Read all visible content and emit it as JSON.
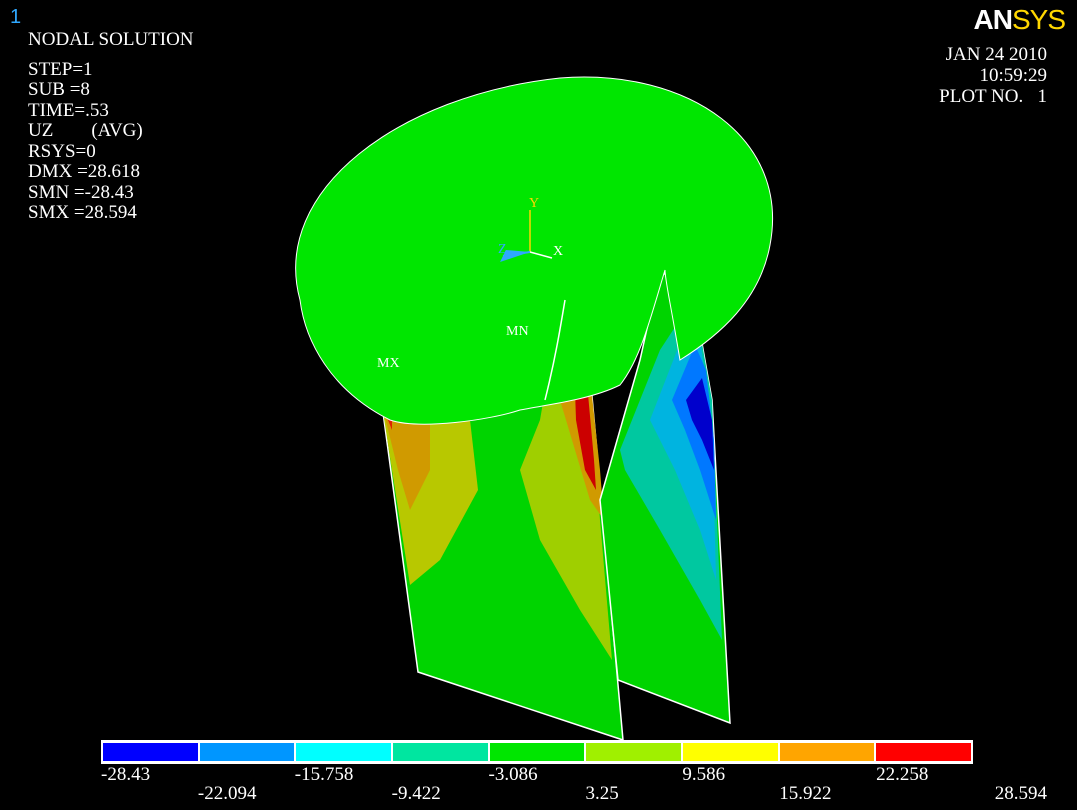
{
  "window_number": "1",
  "logo": {
    "part1": "AN",
    "part2": "SYS"
  },
  "info_lines": [
    "NODAL SOLUTION",
    "STEP=1",
    "SUB =8",
    "TIME=.53",
    "UZ        (AVG)",
    "RSYS=0",
    "DMX =28.618",
    "SMN =-28.43",
    "SMX =28.594"
  ],
  "date": "JAN 24 2010",
  "time": "10:59:29",
  "plot_no": "PLOT NO.   1",
  "markers": {
    "mx": "MX",
    "mn": "MN"
  },
  "axes": {
    "x": "X",
    "y": "Y",
    "z": "Z"
  },
  "legend": {
    "colors": [
      "#0000ff",
      "#0096ff",
      "#00ffff",
      "#00e6a0",
      "#00e600",
      "#a0f000",
      "#ffff00",
      "#ffa500",
      "#ff0000"
    ],
    "labels_top": [
      "-28.43",
      "-15.758",
      "-3.086",
      "9.586",
      "22.258"
    ],
    "labels_bottom": [
      "-22.094",
      "-9.422",
      "3.25",
      "15.922",
      "28.594"
    ]
  }
}
